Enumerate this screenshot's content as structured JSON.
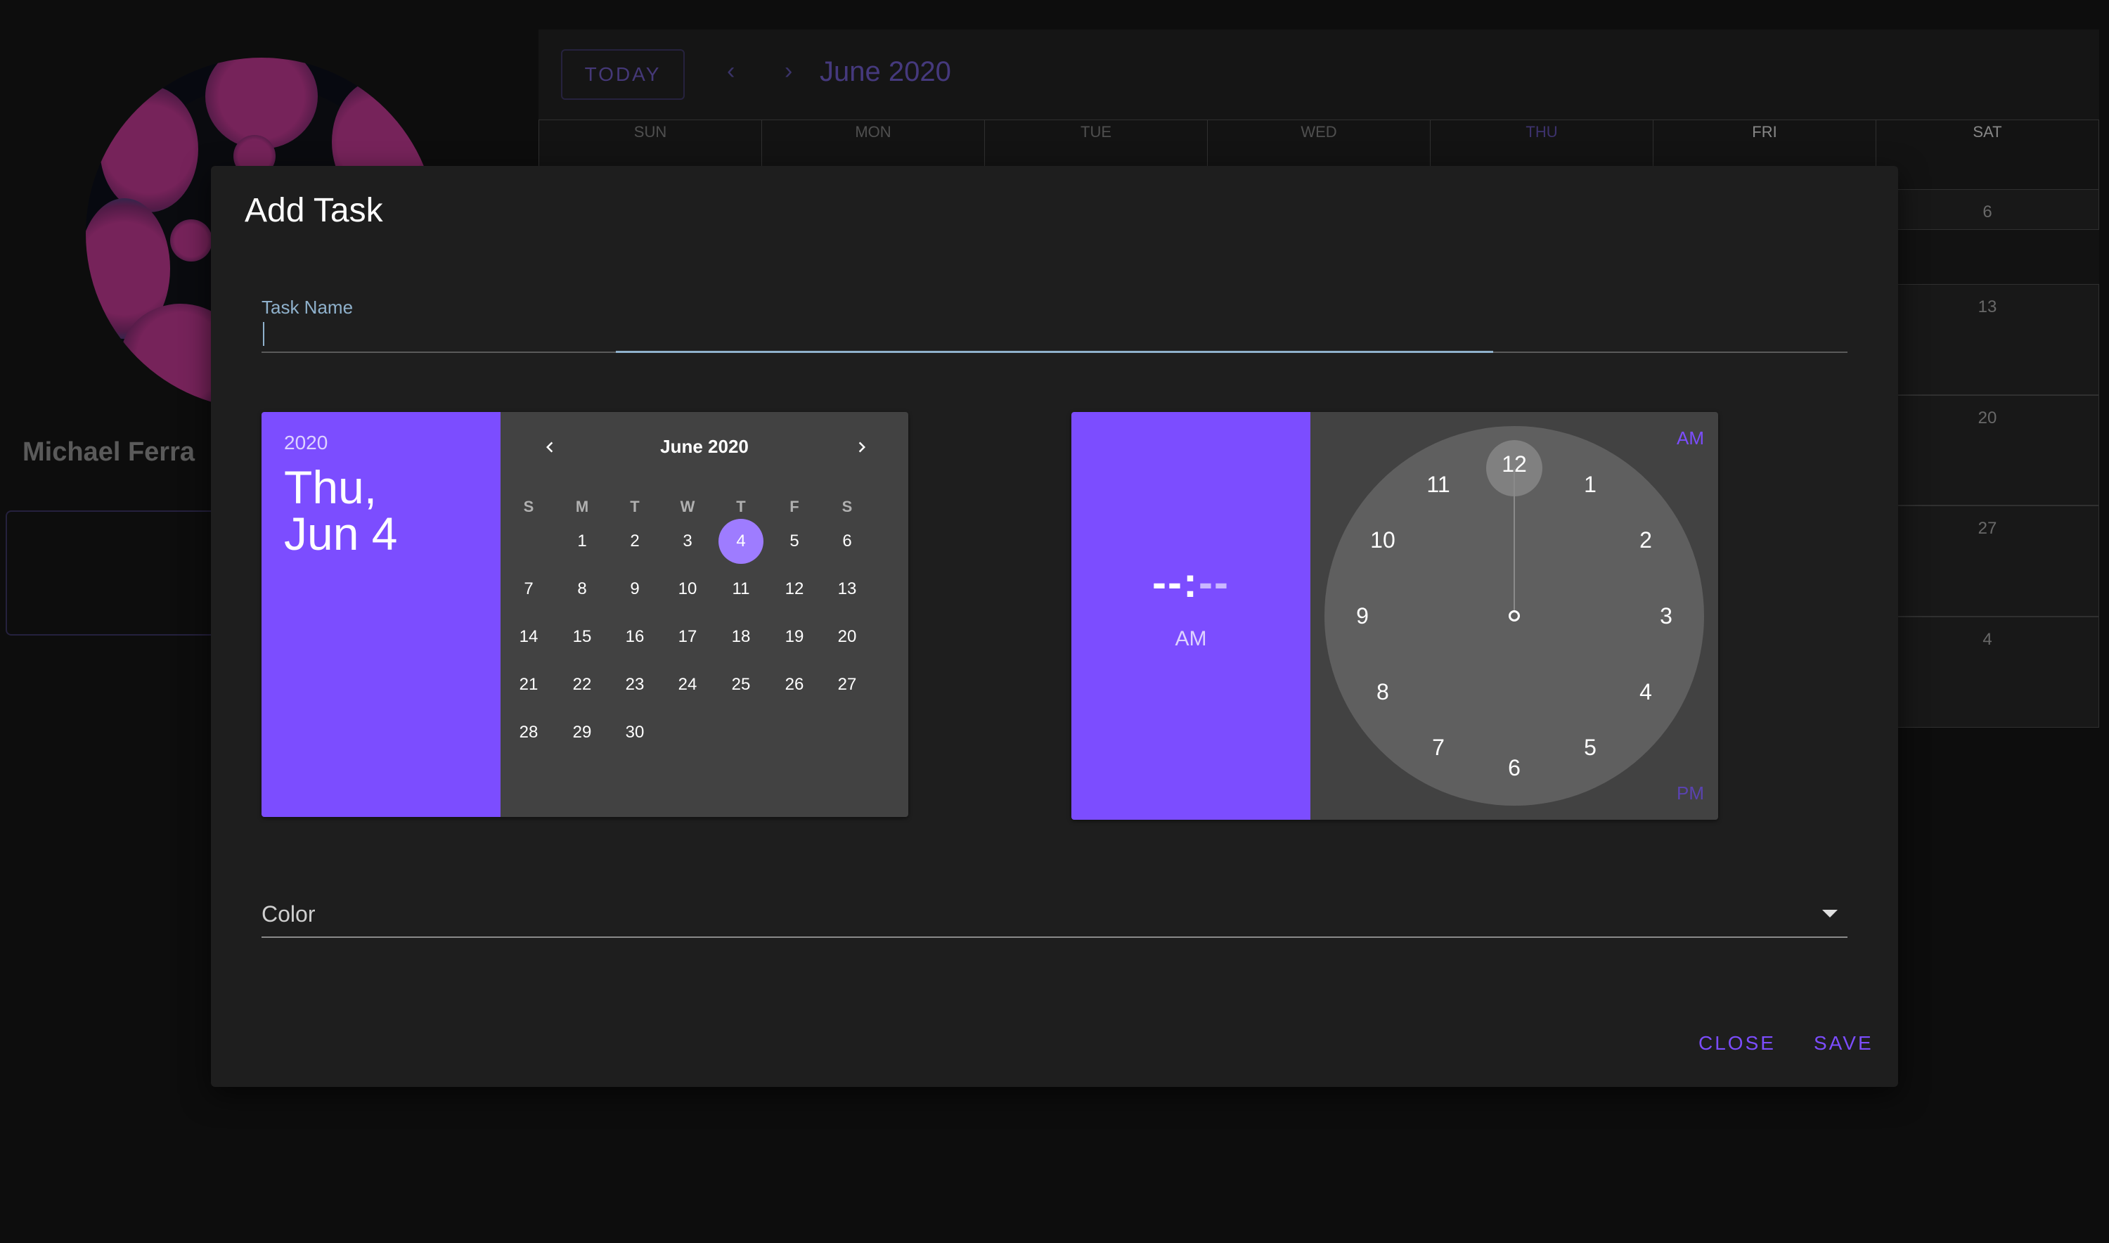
{
  "profile": {
    "name": "Michael Ferra"
  },
  "calendar": {
    "today_label": "TODAY",
    "prev_icon": "‹",
    "next_icon": "›",
    "title": "June 2020",
    "weekdays": [
      "SUN",
      "MON",
      "TUE",
      "WED",
      "THU",
      "FRI",
      "SAT"
    ],
    "visible_dates": [
      "6",
      "13",
      "20",
      "27",
      "4"
    ]
  },
  "dialog": {
    "title": "Add Task",
    "task_name_label": "Task Name",
    "task_name_value": "",
    "date_picker": {
      "year": "2020",
      "date_line1": "Thu,",
      "date_line2": "Jun 4",
      "month_title": "June 2020",
      "prev_icon": "chevron-left-icon",
      "next_icon": "chevron-right-icon",
      "weekdays": [
        "S",
        "M",
        "T",
        "W",
        "T",
        "F",
        "S"
      ],
      "days": [
        "1",
        "2",
        "3",
        "4",
        "5",
        "6",
        "7",
        "8",
        "9",
        "10",
        "11",
        "12",
        "13",
        "14",
        "15",
        "16",
        "17",
        "18",
        "19",
        "20",
        "21",
        "22",
        "23",
        "24",
        "25",
        "26",
        "27",
        "28",
        "29",
        "30"
      ],
      "first_weekday_index": 1,
      "selected_day": "4"
    },
    "time_picker": {
      "hour_display": "--",
      "separator": ":",
      "minute_display": "--",
      "period": "AM",
      "am_label": "AM",
      "pm_label": "PM",
      "clock_numbers": [
        "12",
        "1",
        "2",
        "3",
        "4",
        "5",
        "6",
        "7",
        "8",
        "9",
        "10",
        "11"
      ],
      "selected_hour": "12"
    },
    "color_label": "Color",
    "close_label": "CLOSE",
    "save_label": "SAVE"
  },
  "colors": {
    "accent": "#7c4dff",
    "accent_light": "#9e7cff",
    "dialog_bg": "#1e1e1e",
    "panel_bg": "#424242"
  }
}
